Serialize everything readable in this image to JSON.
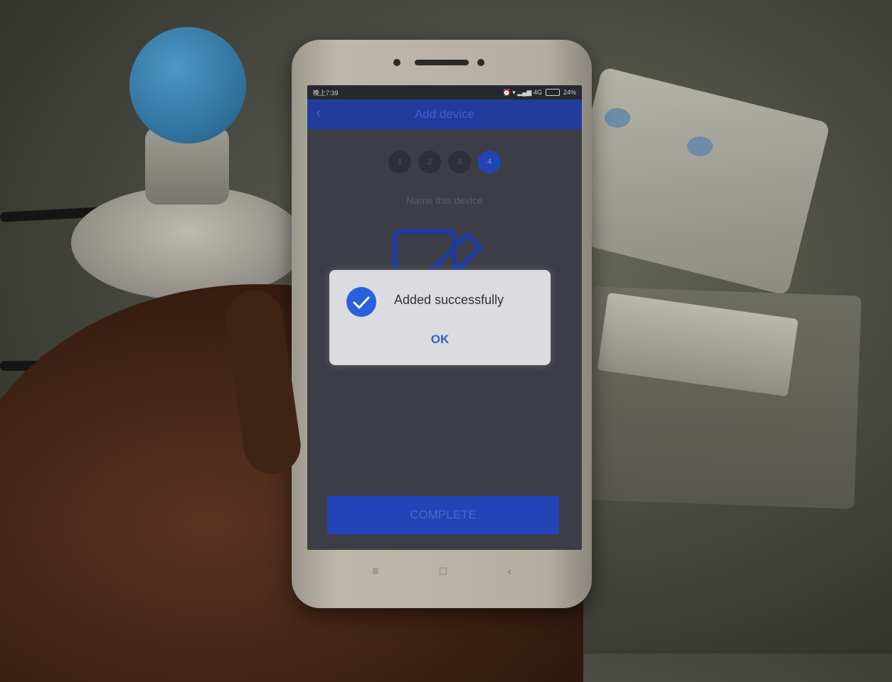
{
  "statusbar": {
    "time": "晚上7:39",
    "indicators": "⏰ ▾ ▂▄▆ 4G",
    "battery": "24%"
  },
  "appbar": {
    "title": "Add device",
    "back_icon": "back-arrow-icon"
  },
  "steps": [
    {
      "label": "1",
      "active": false
    },
    {
      "label": "2",
      "active": false
    },
    {
      "label": "3",
      "active": false
    },
    {
      "label": "4",
      "active": true
    }
  ],
  "form": {
    "name_label": "Name this device",
    "edit_icon": "edit-pencil-icon"
  },
  "complete_button": "COMPLETE",
  "dialog": {
    "message": "Added successfully",
    "ok_label": "OK",
    "icon": "check-circle-icon",
    "accent_color": "#2a5fde"
  },
  "navkeys": {
    "menu": "≡",
    "home": "□",
    "back": "‹"
  }
}
